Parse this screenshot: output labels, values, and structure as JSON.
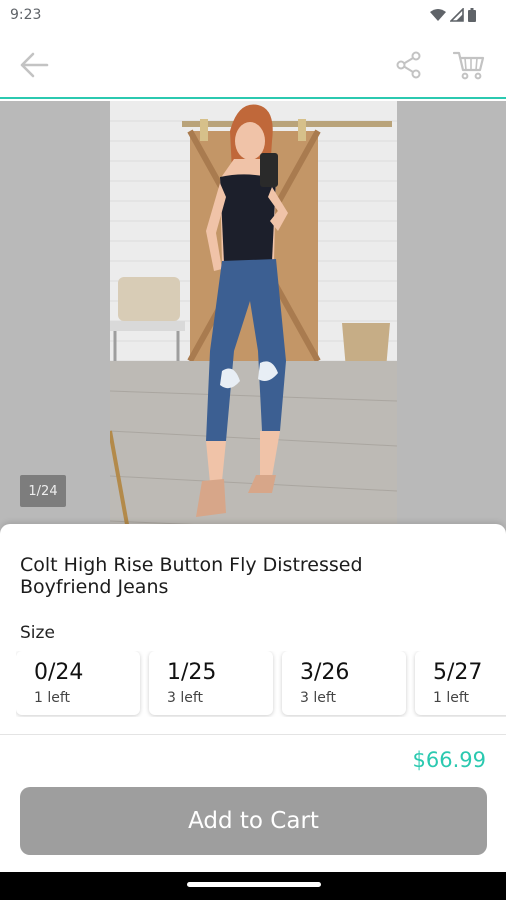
{
  "status_bar": {
    "time": "9:23"
  },
  "gallery": {
    "page_indicator": "1/24"
  },
  "product": {
    "title": "Colt High Rise Button Fly Distressed Boyfriend Jeans",
    "size_label": "Size",
    "sizes": [
      {
        "size": "0/24",
        "stock": "1 left"
      },
      {
        "size": "1/25",
        "stock": "3 left"
      },
      {
        "size": "3/26",
        "stock": "3 left"
      },
      {
        "size": "5/27",
        "stock": "1 left"
      }
    ],
    "price": "$66.99",
    "add_to_cart_label": "Add to Cart"
  },
  "colors": {
    "accent": "#2bc9b0",
    "button_disabled": "#9e9e9e"
  }
}
